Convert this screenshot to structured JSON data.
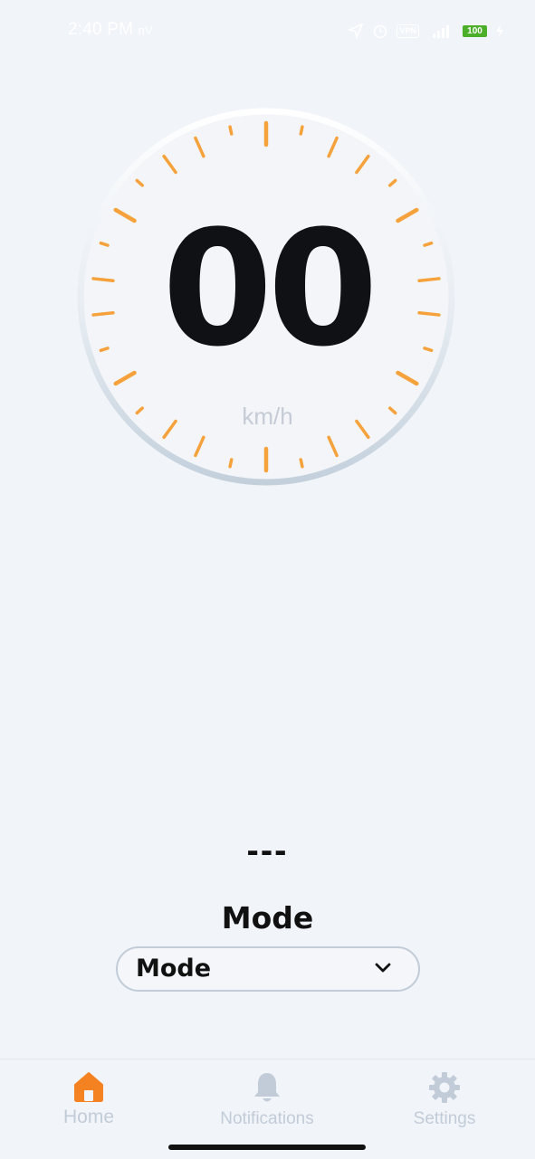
{
  "status_bar": {
    "time": "2:40 PM",
    "carrier": "nV",
    "vpn_label": "VPN",
    "battery": "100"
  },
  "speedometer": {
    "speed": "00",
    "unit": "km/h",
    "tick_color": "#f5a23c",
    "ring_color": "#c6d2dd"
  },
  "mode_section": {
    "current_value": "---",
    "title": "Mode",
    "select_value": "Mode"
  },
  "bottom_nav": {
    "items": [
      {
        "label": "Home",
        "icon": "home-icon",
        "active": true
      },
      {
        "label": "Notifications",
        "icon": "bell-icon",
        "active": false
      },
      {
        "label": "Settings",
        "icon": "gear-icon",
        "active": false
      }
    ],
    "active_color": "#f58220",
    "inactive_color": "#c2ccd8"
  }
}
